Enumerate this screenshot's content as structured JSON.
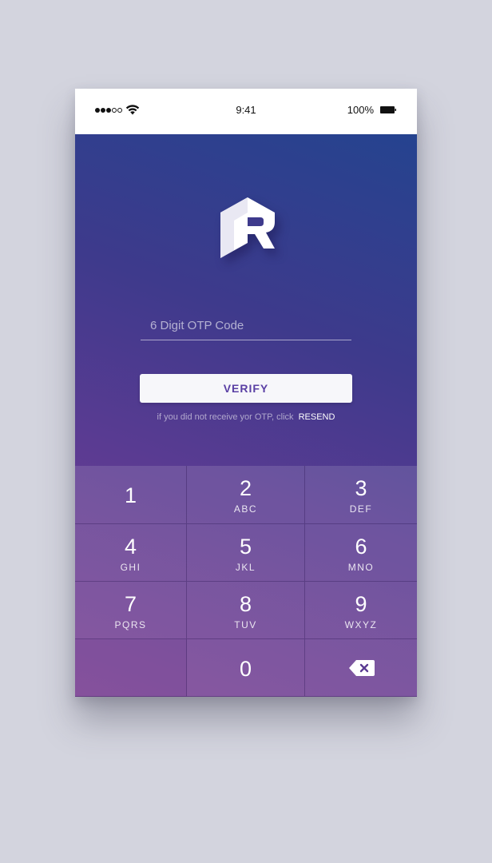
{
  "status_bar": {
    "time": "9:41",
    "battery_percent": "100%",
    "signal_icon": "signal-dots-icon",
    "wifi_icon": "wifi-icon",
    "battery_icon": "battery-icon"
  },
  "brand": {
    "logo_icon": "r-hexagon-logo-icon",
    "gradient_colors": [
      "#25438f",
      "#5a3b92",
      "#7a3f93"
    ]
  },
  "otp": {
    "placeholder": "6 Digit OTP Code",
    "value": ""
  },
  "verify_button": {
    "label": "VERIFY",
    "text_color": "#5a3fa4"
  },
  "resend": {
    "prompt": "if you did not receive yor OTP, click",
    "link_label": "RESEND"
  },
  "keypad": {
    "keys": [
      {
        "digit": "1",
        "letters": ""
      },
      {
        "digit": "2",
        "letters": "ABC"
      },
      {
        "digit": "3",
        "letters": "DEF"
      },
      {
        "digit": "4",
        "letters": "GHI"
      },
      {
        "digit": "5",
        "letters": "JKL"
      },
      {
        "digit": "6",
        "letters": "MNO"
      },
      {
        "digit": "7",
        "letters": "PQRS"
      },
      {
        "digit": "8",
        "letters": "TUV"
      },
      {
        "digit": "9",
        "letters": "WXYZ"
      },
      {
        "digit": "",
        "letters": ""
      },
      {
        "digit": "0",
        "letters": ""
      }
    ],
    "backspace_icon": "backspace-icon"
  }
}
